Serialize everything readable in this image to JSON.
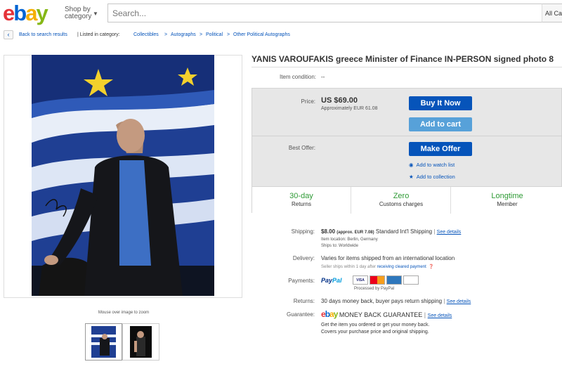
{
  "header": {
    "logo": "ebay",
    "shop_by_line1": "Shop by",
    "shop_by_line2": "category",
    "search_placeholder": "Search...",
    "all_categories": "All Cat"
  },
  "breadcrumb": {
    "back": "Back to search results",
    "listed_in": "| Listed in category:",
    "items": [
      "Collectibles",
      "Autographs",
      "Political",
      "Other Political Autographs"
    ]
  },
  "gallery": {
    "hint": "Mouse over image to zoom"
  },
  "listing": {
    "title": "YANIS VAROUFAKIS greece Minister of Finance IN-PERSON signed photo 8",
    "condition_label": "Item condition:",
    "condition_value": "--"
  },
  "buybox": {
    "price_label": "Price:",
    "price": "US $69.00",
    "approx": "Approximately EUR 61.08",
    "buy_now": "Buy It Now",
    "add_to_cart": "Add to cart",
    "best_offer_label": "Best Offer:",
    "make_offer": "Make Offer",
    "watch": "Add to watch list",
    "collection": "Add to collection",
    "features": [
      {
        "big": "30-day",
        "small": "Returns"
      },
      {
        "big": "Zero",
        "small": "Customs charges"
      },
      {
        "big": "Longtime",
        "small": "Member"
      }
    ]
  },
  "details": {
    "shipping_label": "Shipping:",
    "shipping_cost": "$8.00",
    "shipping_approx": "(approx. EUR 7.08)",
    "shipping_service": "Standard Int'l Shipping",
    "see_details": "See details",
    "item_location": "Item location:  Berlin, Germany",
    "ships_to": "Ships to:  Worldwide",
    "delivery_label": "Delivery:",
    "delivery_value": "Varies for items shipped from an international location",
    "delivery_note": "Seller ships within 1 day after",
    "cleared_payment": "receiving cleared payment",
    "payments_label": "Payments:",
    "paypal_1": "Pay",
    "paypal_2": "Pal",
    "processed_by": "Processed by PayPal",
    "cards": [
      "VISA",
      "MC",
      "AMEX",
      "DISCOVER"
    ],
    "returns_label": "Returns:",
    "returns_value": "30 days money back, buyer pays return shipping",
    "guarantee_label": "Guarantee:",
    "guarantee_title": "MONEY BACK GUARANTEE",
    "guarantee_line1": "Get the item you ordered or get your money back.",
    "guarantee_line2": "Covers your purchase price and original shipping."
  },
  "colors": {
    "link": "#0654ba",
    "buy_button": "#0654ba",
    "cart_button": "#57a1d9",
    "feature_green": "#2d9a34"
  }
}
